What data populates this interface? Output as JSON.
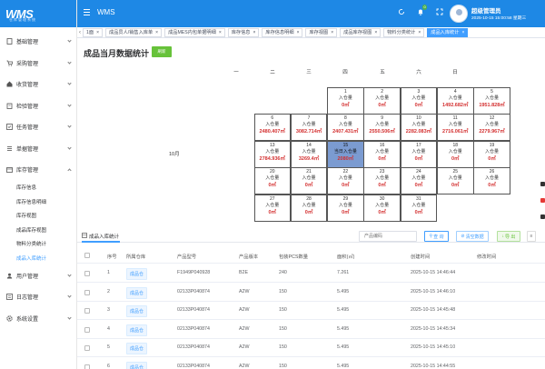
{
  "sidebar": {
    "logo": "WMS",
    "logo_sub": "仓库管理系统",
    "menu": [
      {
        "label": "基础管理"
      },
      {
        "label": "采购管理"
      },
      {
        "label": "收货管理"
      },
      {
        "label": "检验管理"
      },
      {
        "label": "任务管理"
      },
      {
        "label": "单据管理"
      },
      {
        "label": "库存管理"
      }
    ],
    "submenu": [
      {
        "label": "库存信息"
      },
      {
        "label": "库存信息明细"
      },
      {
        "label": "库存视图"
      },
      {
        "label": "成品库存视图"
      },
      {
        "label": "物料分类统计"
      },
      {
        "label": "成品入库统计"
      }
    ],
    "menu2": [
      {
        "label": "用户管理"
      },
      {
        "label": "日志管理"
      },
      {
        "label": "系统设置"
      }
    ]
  },
  "header": {
    "title": "WMS",
    "badge": "0",
    "user_name": "超级管理员",
    "datetime": "2025-10-15 15:00:58 星期三"
  },
  "tabs": [
    {
      "label": "1面"
    },
    {
      "label": "成品员人/销售入库单"
    },
    {
      "label": "成品MES内包单据明细"
    },
    {
      "label": "库存信息"
    },
    {
      "label": "库存信息明细"
    },
    {
      "label": "库存视图"
    },
    {
      "label": "成品库存视图"
    },
    {
      "label": "物料分类统计"
    },
    {
      "label": "成品入库统计"
    }
  ],
  "page": {
    "title": "成品当月数据统计",
    "refresh_label": "刷新",
    "month_label": "10月",
    "weekdays": [
      "一",
      "二",
      "三",
      "四",
      "五",
      "六",
      "日"
    ]
  },
  "calendar": [
    {
      "day": "1",
      "label": "入仓量",
      "value": "0㎡"
    },
    {
      "day": "2",
      "label": "入仓量",
      "value": "0㎡"
    },
    {
      "day": "3",
      "label": "入仓量",
      "value": "0㎡"
    },
    {
      "day": "4",
      "label": "入仓量",
      "value": "1492.682㎡"
    },
    {
      "day": "5",
      "label": "入仓量",
      "value": "1951.828㎡"
    },
    {
      "day": "6",
      "label": "入仓量",
      "value": "2480.407㎡"
    },
    {
      "day": "7",
      "label": "入仓量",
      "value": "3082.714㎡"
    },
    {
      "day": "8",
      "label": "入仓量",
      "value": "2407.431㎡"
    },
    {
      "day": "9",
      "label": "入仓量",
      "value": "2550.506㎡"
    },
    {
      "day": "10",
      "label": "入仓量",
      "value": "2282.083㎡"
    },
    {
      "day": "11",
      "label": "入仓量",
      "value": "2716.061㎡"
    },
    {
      "day": "12",
      "label": "入仓量",
      "value": "2279.967㎡"
    },
    {
      "day": "13",
      "label": "入仓量",
      "value": "2784.936㎡"
    },
    {
      "day": "14",
      "label": "入仓量",
      "value": "3269.4㎡"
    },
    {
      "day": "15",
      "label": "当日入仓量",
      "value": "2080㎡"
    },
    {
      "day": "16",
      "label": "入仓量",
      "value": "0㎡"
    },
    {
      "day": "17",
      "label": "入仓量",
      "value": "0㎡"
    },
    {
      "day": "18",
      "label": "入仓量",
      "value": "0㎡"
    },
    {
      "day": "19",
      "label": "入仓量",
      "value": "0㎡"
    },
    {
      "day": "20",
      "label": "入仓量",
      "value": "0㎡"
    },
    {
      "day": "21",
      "label": "入仓量",
      "value": "0㎡"
    },
    {
      "day": "22",
      "label": "入仓量",
      "value": "0㎡"
    },
    {
      "day": "23",
      "label": "入仓量",
      "value": "0㎡"
    },
    {
      "day": "24",
      "label": "入仓量",
      "value": "0㎡"
    },
    {
      "day": "25",
      "label": "入仓量",
      "value": "0㎡"
    },
    {
      "day": "26",
      "label": "入仓量",
      "value": "0㎡"
    },
    {
      "day": "27",
      "label": "入仓量",
      "value": "0㎡"
    },
    {
      "day": "28",
      "label": "入仓量",
      "value": "0㎡"
    },
    {
      "day": "29",
      "label": "入仓量",
      "value": "0㎡"
    },
    {
      "day": "30",
      "label": "入仓量",
      "value": "0㎡"
    },
    {
      "day": "31",
      "label": "入仓量",
      "value": "0㎡"
    }
  ],
  "table_section": {
    "title": "成品入库统计",
    "search_placeholder": "产品编码",
    "search_btn": "查 询",
    "clear_btn": "清空数据",
    "export_btn": "导 出",
    "columns": [
      "序号",
      "所属仓库",
      "产品型号",
      "产品版本",
      "包装PCS数量",
      "面积(㎡)",
      "创建时间",
      "修改时间"
    ],
    "rows": [
      {
        "no": "1",
        "warehouse": "成品仓",
        "model": "F1949P040928",
        "version": "B2E",
        "pcs": "240",
        "area": "7.261",
        "created": "2025-10-15 14:46:44",
        "modified": ""
      },
      {
        "no": "2",
        "warehouse": "成品仓",
        "model": "02133P040874",
        "version": "A2W",
        "pcs": "150",
        "area": "5.495",
        "created": "2025-10-15 14:46:10",
        "modified": ""
      },
      {
        "no": "3",
        "warehouse": "成品仓",
        "model": "02133P040874",
        "version": "A2W",
        "pcs": "150",
        "area": "5.495",
        "created": "2025-10-15 14:45:48",
        "modified": ""
      },
      {
        "no": "4",
        "warehouse": "成品仓",
        "model": "02133P040874",
        "version": "A2W",
        "pcs": "150",
        "area": "5.495",
        "created": "2025-10-15 14:45:34",
        "modified": ""
      },
      {
        "no": "5",
        "warehouse": "成品仓",
        "model": "02133P040874",
        "version": "A2W",
        "pcs": "150",
        "area": "5.495",
        "created": "2025-10-15 14:45:10",
        "modified": ""
      },
      {
        "no": "6",
        "warehouse": "成品仓",
        "model": "02133P040874",
        "version": "A2W",
        "pcs": "150",
        "area": "5.495",
        "created": "2025-10-15 14:44:55",
        "modified": ""
      }
    ]
  },
  "colors": {
    "primary": "#1e88e5",
    "accent": "#409eff",
    "success": "#67c23a",
    "value_red": "#d32f2f",
    "today": "#7b9bd1"
  }
}
